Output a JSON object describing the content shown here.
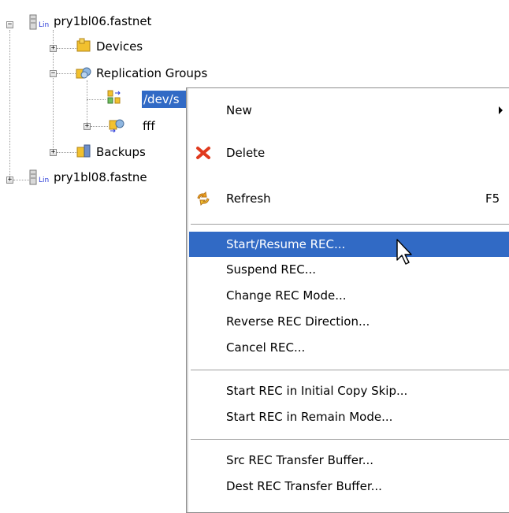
{
  "tree": {
    "server1": {
      "label": "pry1bl06.fastnet",
      "expanded": true,
      "icon": "linux-server-icon"
    },
    "devices": {
      "label": "Devices",
      "icon": "devices-folder-icon"
    },
    "replication_groups": {
      "label": "Replication Groups",
      "expanded": true,
      "icon": "replication-groups-icon"
    },
    "rep_item": {
      "label": "/dev/s",
      "selected": true,
      "icon": "replication-pair-icon"
    },
    "fff": {
      "label": "fff",
      "icon": "replication-group-icon"
    },
    "backups": {
      "label": "Backups",
      "icon": "backups-folder-icon"
    },
    "server2": {
      "label": "pry1bl08.fastne",
      "icon": "linux-server-icon"
    },
    "lin_badge": "Lin"
  },
  "context_menu": {
    "new": {
      "label": "New",
      "has_submenu": true
    },
    "delete": {
      "label": "Delete",
      "icon": "delete-x-icon"
    },
    "refresh": {
      "label": "Refresh",
      "shortcut": "F5",
      "icon": "refresh-icon"
    },
    "start_resume": {
      "label": "Start/Resume REC...",
      "highlighted": true
    },
    "suspend": {
      "label": "Suspend REC..."
    },
    "change_mode": {
      "label": "Change REC Mode..."
    },
    "reverse_direction": {
      "label": "Reverse REC Direction..."
    },
    "cancel": {
      "label": "Cancel REC..."
    },
    "start_initial_copy_skip": {
      "label": "Start REC in Initial Copy Skip..."
    },
    "start_remain_mode": {
      "label": "Start REC in Remain Mode..."
    },
    "src_buffer": {
      "label": "Src REC Transfer Buffer..."
    },
    "dest_buffer": {
      "label": "Dest REC Transfer Buffer..."
    }
  },
  "colors": {
    "selection": "#316ac5",
    "delete_icon": "#e03a1e",
    "folder_yellow": "#f2c12e"
  }
}
